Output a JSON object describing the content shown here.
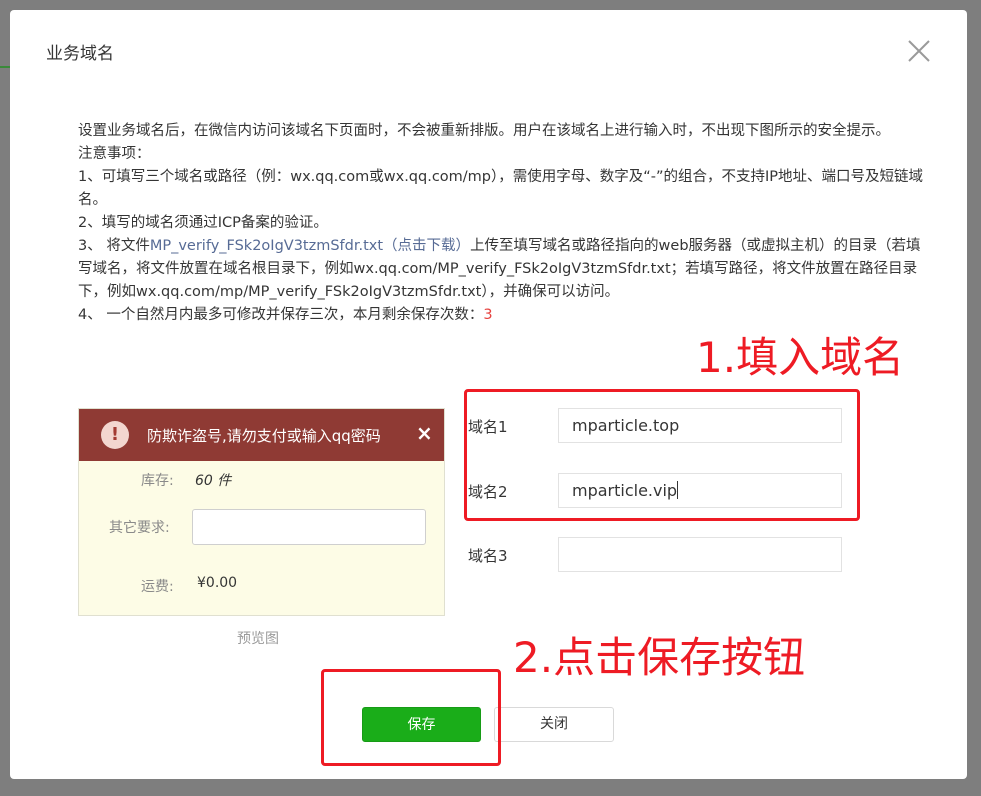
{
  "dialog": {
    "title": "业务域名",
    "intro_lines": [
      "设置业务域名后，在微信内访问该域名下页面时，不会被重新排版。用户在该域名上进行输入时，不出现下图所示的安全提示。",
      "注意事项：",
      "1、可填写三个域名或路径（例：wx.qq.com或wx.qq.com/mp），需使用字母、数字及“-”的组合，不支持IP地址、端口号及短链域名。",
      "2、填写的域名须通过ICP备案的验证。"
    ],
    "note3_prefix": "3、 将文件",
    "note3_link": "MP_verify_FSk2oIgV3tzmSfdr.txt（点击下载）",
    "note3_suffix": "上传至填写域名或路径指向的web服务器（或虚拟主机）的目录（若填写域名，将文件放置在域名根目录下，例如wx.qq.com/MP_verify_FSk2oIgV3tzmSfdr.txt；若填写路径，将文件放置在路径目录下，例如wx.qq.com/mp/MP_verify_FSk2oIgV3tzmSfdr.txt），并确保可以访问。",
    "note4_prefix": "4、 一个自然月内最多可修改并保存三次，本月剩余保存次数：",
    "note4_count": "3",
    "preview": {
      "warning": "防欺诈盗号,请勿支付或输入qq密码",
      "warn_icon": "!",
      "warn_close": "×",
      "stock_label": "库存:",
      "stock_value": "60 件",
      "other_label": "其它要求:",
      "fee_label": "运费:",
      "fee_value": "¥0.00",
      "caption": "预览图"
    },
    "domains": [
      {
        "label": "域名1",
        "value": "mparticle.top"
      },
      {
        "label": "域名2",
        "value": "mparticle.vip"
      },
      {
        "label": "域名3",
        "value": ""
      }
    ],
    "save_label": "保存",
    "close_label": "关闭"
  },
  "annotations": {
    "step1": "1.填入域名",
    "step2": "2.点击保存按钮",
    "color": "#ee1b24"
  },
  "colors": {
    "primary_button": "#1aad19",
    "link": "#576b95",
    "warning_bar": "#8f3a34"
  }
}
